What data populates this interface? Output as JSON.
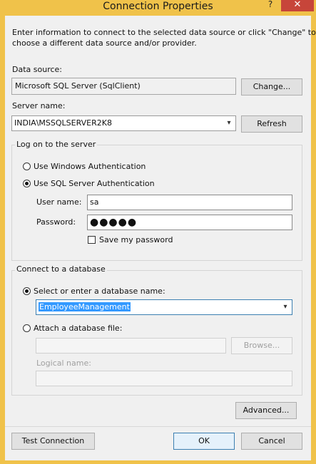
{
  "window": {
    "title": "Connection Properties",
    "help_glyph": "?",
    "close_glyph": "✕",
    "colors": {
      "frame": "#f0c24a",
      "close_button": "#c7453a",
      "selection": "#3399ff",
      "primary_border": "#3c7fb1"
    }
  },
  "intro": {
    "line1": "Enter information to connect to the selected data source or click \"Change\" to",
    "line2": "choose a different data source and/or provider."
  },
  "datasource": {
    "label": "Data source:",
    "value": "Microsoft SQL Server (SqlClient)",
    "change_label": "Change..."
  },
  "server": {
    "label": "Server name:",
    "value": "INDIA\\MSSQLSERVER2K8",
    "refresh_label": "Refresh"
  },
  "logon": {
    "legend": "Log on to the server",
    "windows_auth_label": "Use Windows Authentication",
    "windows_auth_selected": false,
    "sql_auth_label": "Use SQL Server Authentication",
    "sql_auth_selected": true,
    "username_label": "User name:",
    "username_value": "sa",
    "password_label": "Password:",
    "password_mask": "●●●●●",
    "save_password_label": "Save my password",
    "save_password_checked": false
  },
  "database": {
    "legend": "Connect to a database",
    "select_label": "Select or enter a database name:",
    "select_selected": true,
    "db_name_value": "EmployeeManagement",
    "attach_label": "Attach a database file:",
    "attach_selected": false,
    "attach_file_value": "",
    "browse_label": "Browse...",
    "logical_name_label": "Logical name:",
    "logical_name_value": ""
  },
  "advanced_label": "Advanced...",
  "footer": {
    "test_label": "Test Connection",
    "ok_label": "OK",
    "cancel_label": "Cancel"
  },
  "icons": {
    "dropdown": "chevron-down-icon",
    "help": "help-icon",
    "close": "close-icon"
  }
}
